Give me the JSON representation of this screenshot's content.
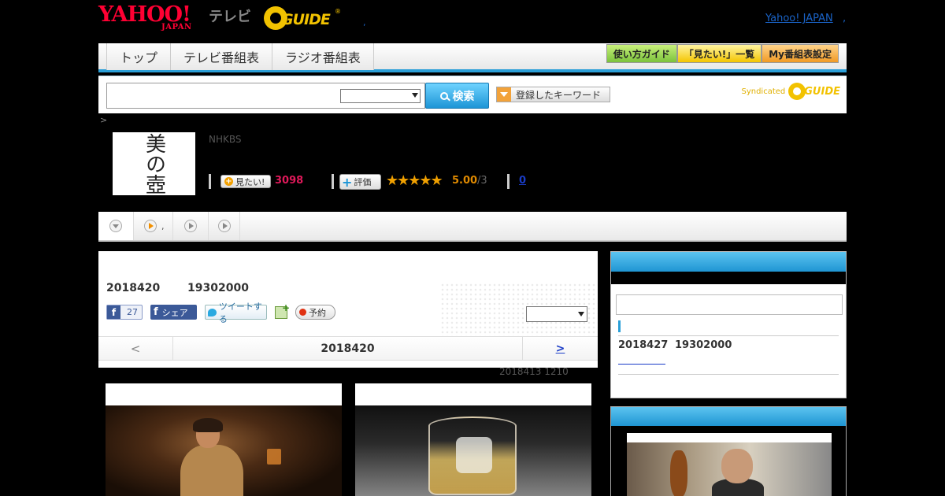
{
  "header": {
    "yahoo_logo_main": "YAHOO!",
    "yahoo_logo_sub": "JAPAN",
    "tv_label": "テレビ",
    "gguide_logo": "GUIDE",
    "head_dot": ",",
    "yahoo_japan_link": "Yahoo! JAPAN",
    "yahoo_japan_dot": ","
  },
  "nav": {
    "tabs": [
      "トップ",
      "テレビ番組表",
      "ラジオ番組表"
    ],
    "buttons": [
      "使い方ガイド",
      "「見たい!」一覧",
      "My番組表設定"
    ]
  },
  "search": {
    "placeholder": "",
    "button_label": "検索",
    "keyword_button": "登録したキーワード",
    "syndicated_label": "Syndicated",
    "syndicated_logo": "GUIDE"
  },
  "breadcrumb": ">",
  "program": {
    "image_text": "美の壺",
    "channel": "NHKBS",
    "want_label": "見たい!",
    "want_count": "3098",
    "rate_label": "評価",
    "stars": "★★★★★",
    "score": "5.00",
    "score_den": "/3",
    "review_count": "0"
  },
  "tabs": [
    {
      "label": "",
      "icon": "chevron-down-icon"
    },
    {
      "label": ",",
      "icon": "play-icon"
    },
    {
      "label": "",
      "icon": "play-icon"
    },
    {
      "label": "",
      "icon": "play-icon"
    }
  ],
  "main": {
    "air_date": "2018420",
    "air_time": "19302000",
    "fb_count": "27",
    "fb_share": "シェア",
    "tweet": "ツイートする",
    "reserve": "予約",
    "pager_prev": "<",
    "pager_current": "2018420",
    "pager_next": ">",
    "updated": "2018413  1210"
  },
  "side": {
    "next_date": "2018427",
    "next_time": "19302000"
  },
  "colors": {
    "accent_blue": "#2a9fd8",
    "want_pink": "#e0195a",
    "star_orange": "#f0a000"
  }
}
